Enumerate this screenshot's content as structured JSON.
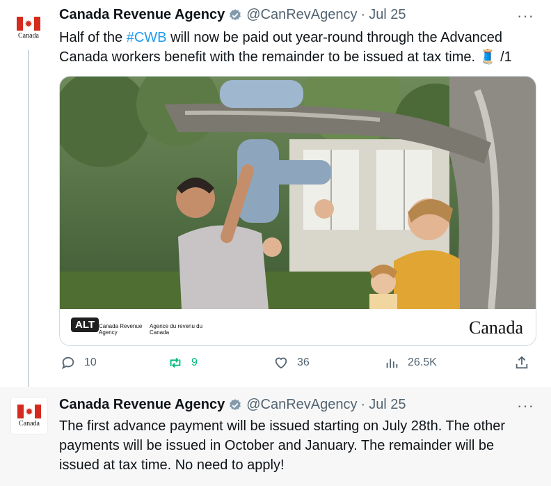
{
  "tweet1": {
    "display_name": "Canada Revenue Agency",
    "handle": "@CanRevAgency",
    "separator": "·",
    "date": "Jul 25",
    "more": "···",
    "text_before": "Half of the ",
    "hashtag": "#CWB",
    "text_after": " will now be paid out year-round through the Advanced Canada workers benefit with the remainder to be issued at tax time. 🧵 /1",
    "avatar_word": "Canada",
    "media": {
      "alt_badge": "ALT",
      "agency_en": "Canada Revenue Agency",
      "agency_fr": "Agence du revenu du Canada",
      "wordmark": "Canada"
    },
    "actions": {
      "replies": "10",
      "retweets": "9",
      "likes": "36",
      "views": "26.5K"
    }
  },
  "tweet2": {
    "display_name": "Canada Revenue Agency",
    "handle": "@CanRevAgency",
    "separator": "·",
    "date": "Jul 25",
    "more": "···",
    "text": "The first advance payment will be issued starting on July 28th. The other payments will be issued in October and January. The remainder will be issued at tax time. No need to apply!",
    "avatar_word": "Canada"
  },
  "colors": {
    "link": "#1d9bf0",
    "retweet": "#00ba7c",
    "muted": "#536471",
    "flag_red": "#d52b1e"
  }
}
